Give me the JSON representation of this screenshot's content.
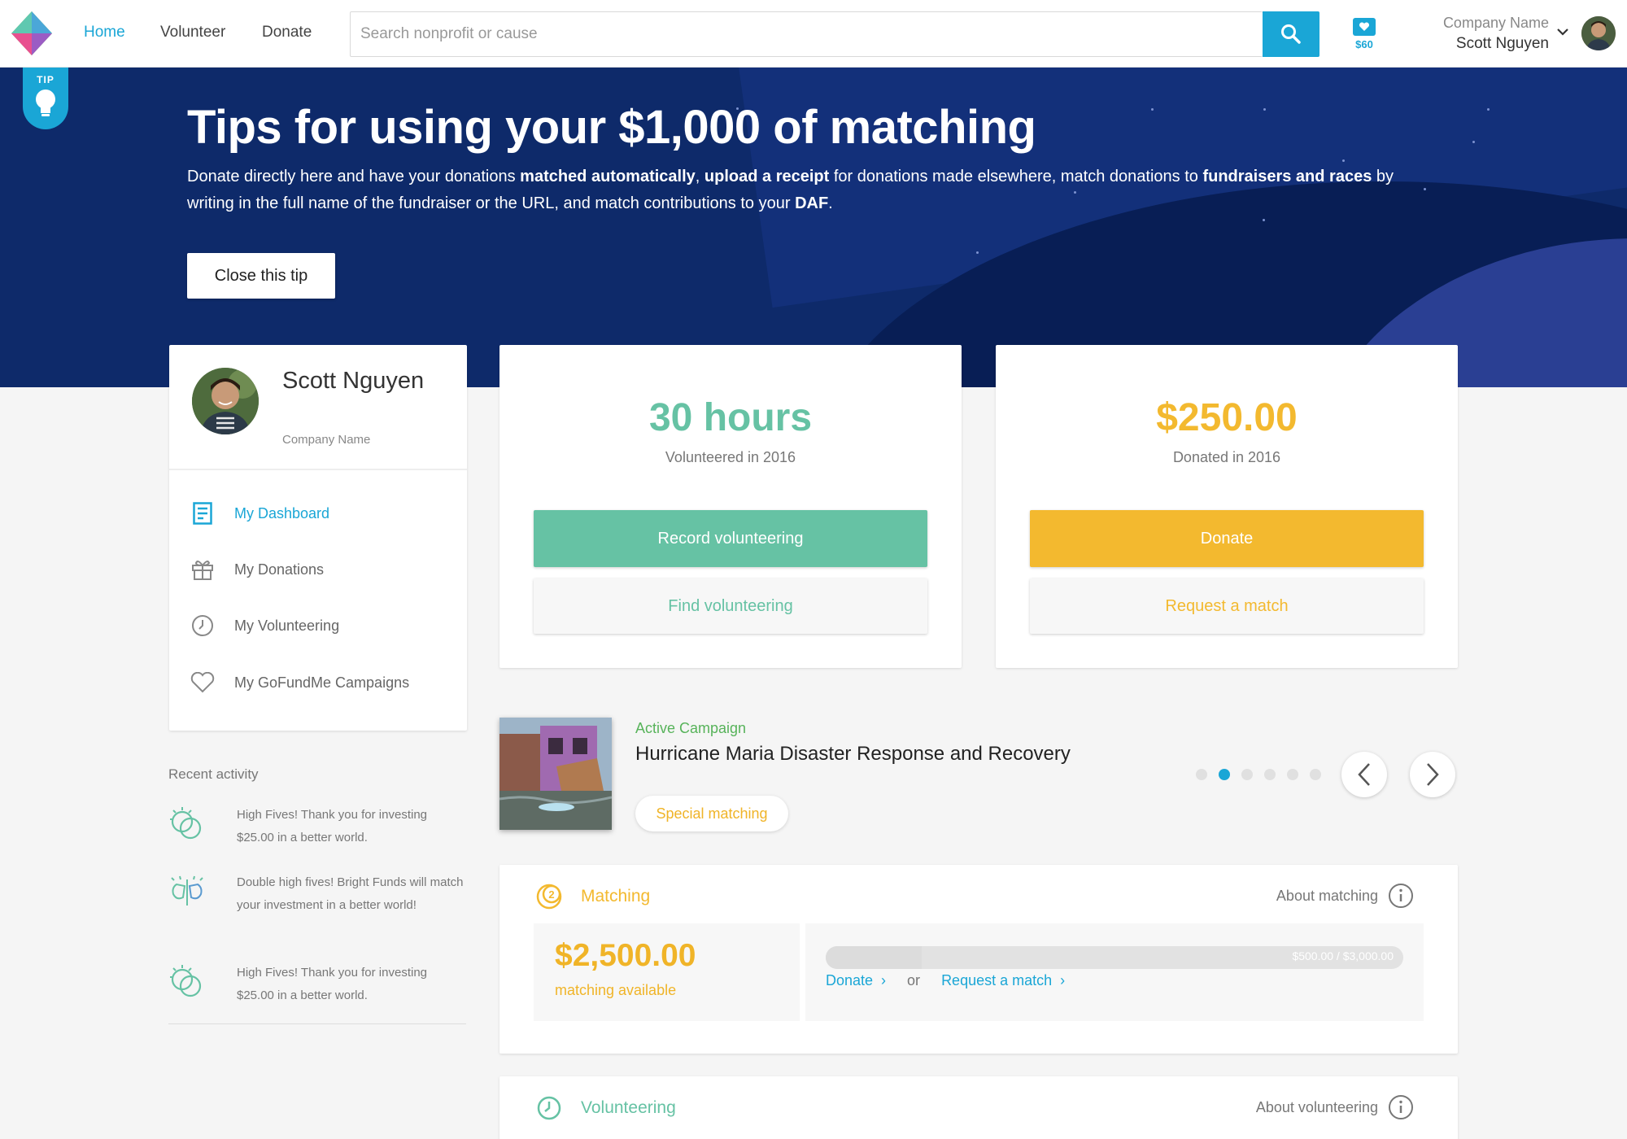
{
  "nav": {
    "links": [
      "Home",
      "Volunteer",
      "Donate"
    ],
    "search_placeholder": "Search nonprofit or cause",
    "wallet_amount": "$60",
    "company": "Company Name",
    "user": "Scott Nguyen"
  },
  "hero": {
    "tip_label": "TIP",
    "title": "Tips for using your $1,000 of matching",
    "body_parts": [
      {
        "t": "Donate directly here and have your donations ",
        "b": false
      },
      {
        "t": "matched automatically",
        "b": true
      },
      {
        "t": ", ",
        "b": false
      },
      {
        "t": "upload a receipt",
        "b": true
      },
      {
        "t": " for donations made elsewhere, match donations to ",
        "b": false
      },
      {
        "t": "fundraisers and races",
        "b": true
      },
      {
        "t": " by writing in the full name of the fundraiser or the URL, and match contributions to your ",
        "b": false
      },
      {
        "t": "DAF",
        "b": true
      },
      {
        "t": ".",
        "b": false
      }
    ],
    "close_label": "Close this tip"
  },
  "profile": {
    "name": "Scott Nguyen",
    "company": "Company Name",
    "menu": [
      {
        "label": "My Dashboard",
        "icon": "dashboard-icon",
        "active": true
      },
      {
        "label": "My Donations",
        "icon": "gift-icon",
        "active": false
      },
      {
        "label": "My Volunteering",
        "icon": "clock-icon",
        "active": false
      },
      {
        "label": "My GoFundMe Campaigns",
        "icon": "heart-icon",
        "active": false
      }
    ]
  },
  "volunteer_stat": {
    "value": "30 hours",
    "caption": "Volunteered in 2016",
    "primary_label": "Record volunteering",
    "secondary_label": "Find volunteering",
    "color": "#66c2a4"
  },
  "donation_stat": {
    "value": "$250.00",
    "caption": "Donated in 2016",
    "primary_label": "Donate",
    "secondary_label": "Request a match",
    "color": "#f3b92f"
  },
  "recent": {
    "title": "Recent activity",
    "items": [
      {
        "text": "High Fives! Thank you for investing $25.00 in a better world.",
        "icon": "high-five-icon"
      },
      {
        "text": "Double high fives! Bright Funds will match your investment in a better world!",
        "icon": "double-high-five-icon"
      },
      {
        "text": "High Fives! Thank you for investing $25.00 in a better world.",
        "icon": "high-five-icon"
      }
    ]
  },
  "campaign": {
    "label": "Active Campaign",
    "title": "Hurricane Maria Disaster Response and Recovery",
    "pill": "Special matching",
    "dot_count": 6,
    "active_dot": 1
  },
  "matching": {
    "heading": "Matching",
    "about": "About matching",
    "amount": "$2,500.00",
    "amount_label": "matching available",
    "progress_text": "$500.00 / $3,000.00",
    "progress_fraction": 0.1667,
    "donate_link": "Donate",
    "or_text": "or",
    "request_link": "Request a match"
  },
  "volunteering": {
    "heading": "Volunteering",
    "about": "About volunteering"
  },
  "colors": {
    "accent": "#1aa6d6",
    "green": "#66c2a4",
    "yellow": "#f3b92f",
    "hero_bg": "#0e2a6a"
  }
}
